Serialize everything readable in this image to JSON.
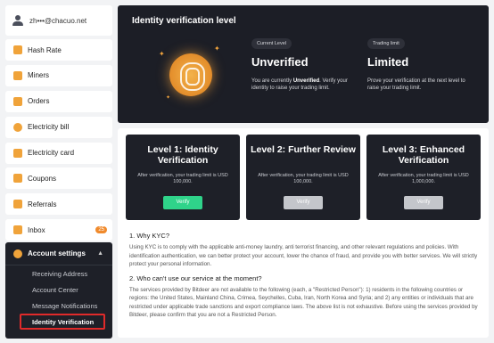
{
  "user": {
    "email": "zh•••@chacuo.net"
  },
  "sidebar": {
    "items": [
      {
        "label": "Hash Rate"
      },
      {
        "label": "Miners"
      },
      {
        "label": "Orders"
      },
      {
        "label": "Electricity bill"
      },
      {
        "label": "Electricity card"
      },
      {
        "label": "Coupons"
      },
      {
        "label": "Referrals"
      },
      {
        "label": "Inbox",
        "badge": "25"
      }
    ],
    "account": {
      "label": "Account settings",
      "subitems": [
        "Receiving Address",
        "Account Center",
        "Message Notifications",
        "Identity Verification"
      ]
    }
  },
  "hero": {
    "title": "Identity verification level",
    "current_tag": "Current Level",
    "current_value": "Unverified",
    "current_desc_pre": "You are currently ",
    "current_desc_bold": "Unverified",
    "current_desc_post": ". Verify your identity to raise your trading limit.",
    "limit_tag": "Trading limit",
    "limit_value": "Limited",
    "limit_desc": "Prove your verification at the next level to raise your trading limit."
  },
  "levels": [
    {
      "title": "Level 1: Identity Verification",
      "desc": "After verification, your trading limit is USD 100,000.",
      "button": "Verify"
    },
    {
      "title": "Level 2: Further Review",
      "desc": "After verification, your trading limit is USD 100,000.",
      "button": "Verify"
    },
    {
      "title": "Level 3: Enhanced Verification",
      "desc": "After verification, your trading limit is USD 1,000,000.",
      "button": "Verify"
    }
  ],
  "faq": [
    {
      "q": "1. Why KYC?",
      "a": "Using KYC is to comply with the applicable anti-money laundry, anti terrorist financing, and other relevant regulations and policies. With identification authentication, we can better protect your account, lower the chance of fraud, and provide you with better services. We will strictly protect your personal information."
    },
    {
      "q": "2. Who can't use our service at the moment?",
      "a": "The services provided by Bitdeer are not available to the following (each, a \"Restricted Person\"): 1) residents in the following countries or regions: the United States, Mainland China, Crimea, Seychelles, Cuba, Iran, North Korea and Syria; and 2) any entities or individuals that are restricted under applicable trade sanctions and export compliance laws. The above list is not exhaustive. Before using the services provided by Bitdeer, please confirm that you are not a Restricted Person."
    }
  ],
  "colors": {
    "accent": "#f0a33a",
    "verify_active": "#2fd38a",
    "verify_disabled": "#c4c6cb",
    "highlight": "#e02a2a"
  }
}
